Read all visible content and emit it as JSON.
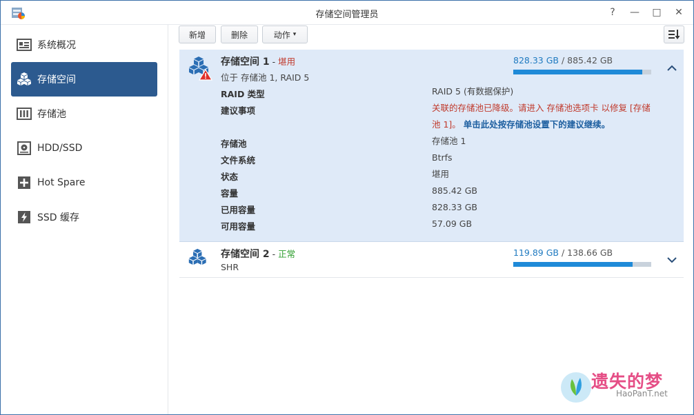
{
  "window": {
    "title": "存储空间管理员"
  },
  "window_controls": [
    "?",
    "—",
    "□",
    "✕"
  ],
  "sidebar": {
    "items": [
      {
        "label": "系统概况",
        "icon": "overview-icon",
        "active": false
      },
      {
        "label": "存储空间",
        "icon": "volume-icon",
        "active": true
      },
      {
        "label": "存储池",
        "icon": "storage-pool-icon",
        "active": false
      },
      {
        "label": "HDD/SSD",
        "icon": "disk-icon",
        "active": false
      },
      {
        "label": "Hot Spare",
        "icon": "hot-spare-icon",
        "active": false
      },
      {
        "label": "SSD 缓存",
        "icon": "ssd-cache-icon",
        "active": false
      }
    ]
  },
  "toolbar": {
    "create": "新增",
    "delete": "删除",
    "action": "动作",
    "action_caret": "▾"
  },
  "volumes": [
    {
      "name": "存储空间 1",
      "sep": " - ",
      "status": "堪用",
      "location": "位于 存储池 1, RAID 5",
      "used": "828.33 GB",
      "slash": " / ",
      "total": "885.42 GB",
      "usage_fraction": 0.9355,
      "expanded": true,
      "details": {
        "raid_type_label": "RAID 类型",
        "raid_type_value": "RAID 5 (有数据保护)",
        "suggestion_label": "建议事项",
        "suggestion_red": "关联的存储池已降级。请进入 存储池选项卡 以修复 [存储池 1]。",
        "suggestion_link": "单击此处按存储池设置下的建议继续。",
        "pool_label": "存储池",
        "pool_value": "存储池 1",
        "fs_label": "文件系统",
        "fs_value": "Btrfs",
        "status_label": "状态",
        "status_value": "堪用",
        "capacity_label": "容量",
        "capacity_value": "885.42 GB",
        "used_label": "已用容量",
        "used_value": "828.33 GB",
        "free_label": "可用容量",
        "free_value": "57.09 GB"
      }
    },
    {
      "name": "存储空间 2",
      "sep": " - ",
      "status": "正常",
      "location": "SHR",
      "used": "119.89 GB",
      "slash": " / ",
      "total": "138.66 GB",
      "usage_fraction": 0.8646,
      "expanded": false
    }
  ],
  "watermark": {
    "text": "遗失的梦",
    "sub": "HaoPanT.net"
  },
  "colors": {
    "sidebar_active": "#2c5a8f",
    "panel_bg": "#dfeaf8",
    "bar_fill": "#1f8ad8",
    "warning": "#c0392b",
    "ok": "#2e9e2e"
  }
}
